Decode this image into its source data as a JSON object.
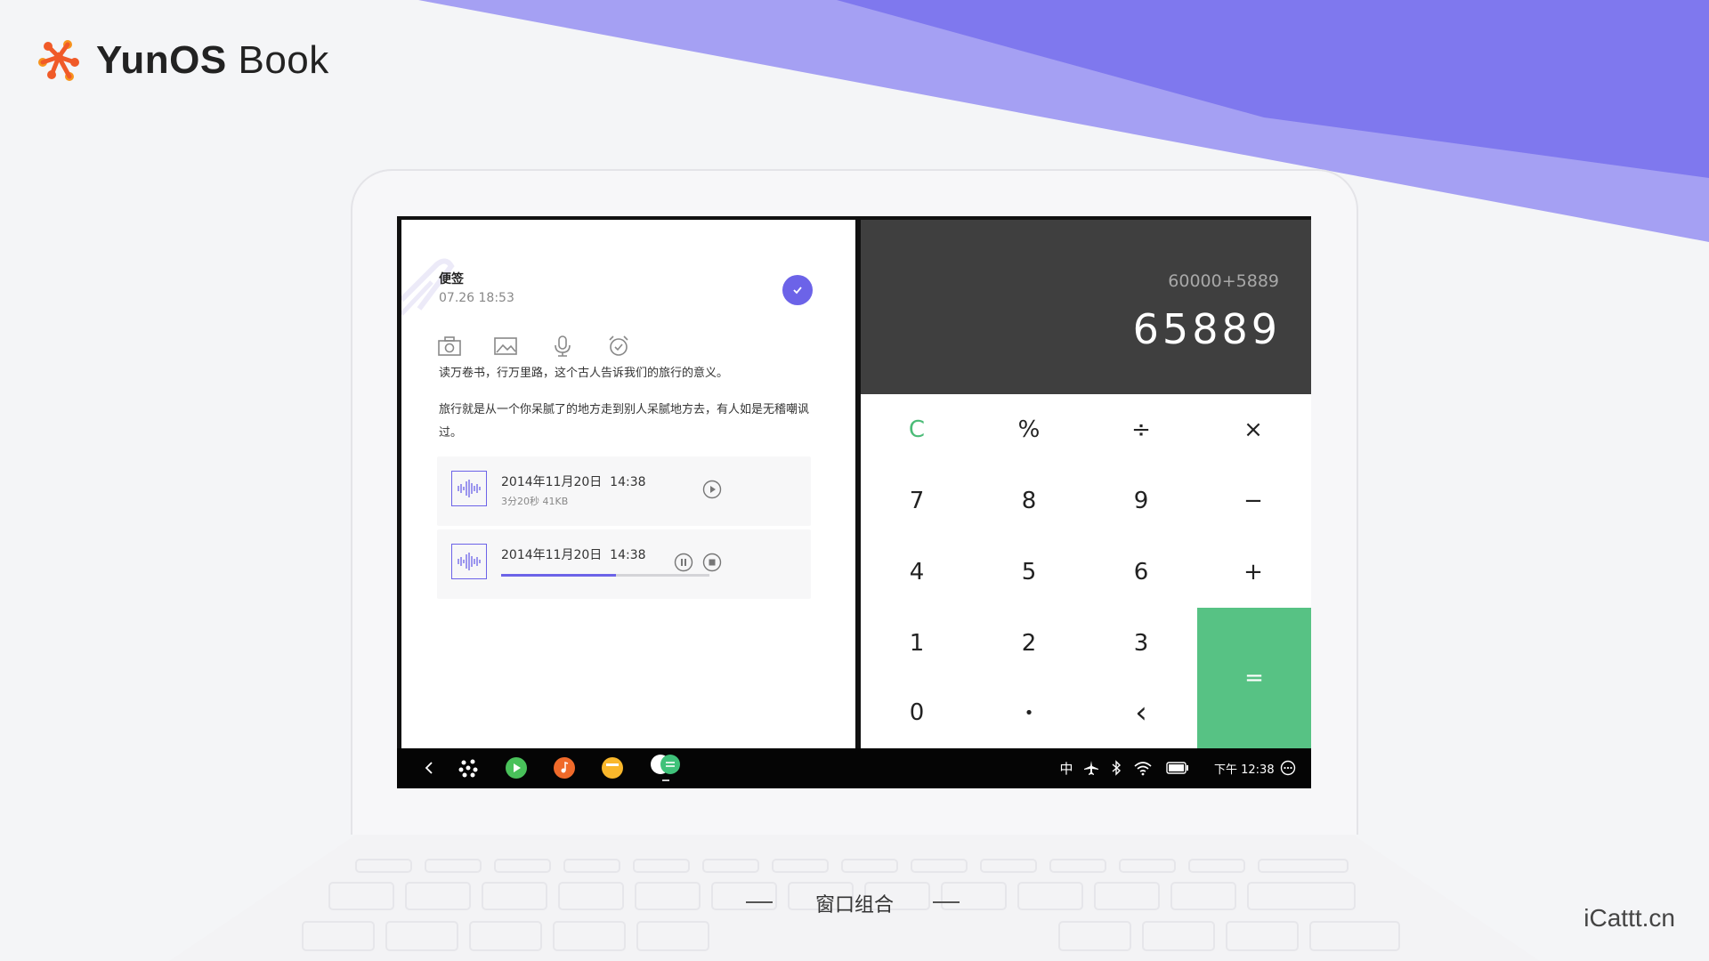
{
  "brand": {
    "name_bold": "YunOS",
    "name_light": " Book"
  },
  "notes": {
    "title": "便签",
    "date": "07.26 18:53",
    "paragraph1": "读万卷书，行万里路，这个古人告诉我们的旅行的意义。",
    "paragraph2": "旅行就是从一个你呆腻了的地方走到别人呆腻地方去，有人如是无稽嘲讽过。",
    "recordings": [
      {
        "date": "2014年11月20日",
        "time": "14:38",
        "meta": "3分20秒  41KB",
        "state": "stopped"
      },
      {
        "date": "2014年11月20日",
        "time": "14:38",
        "state": "playing",
        "progress": 0.55
      }
    ]
  },
  "calculator": {
    "expression": "60000+5889",
    "result": "65889",
    "keys": {
      "clear": "C",
      "percent": "%",
      "divide": "÷",
      "multiply": "×",
      "seven": "7",
      "eight": "8",
      "nine": "9",
      "minus": "−",
      "four": "4",
      "five": "5",
      "six": "6",
      "plus": "+",
      "one": "1",
      "two": "2",
      "three": "3",
      "equals": "=",
      "zero": "0",
      "dot": "•",
      "backspace": "‹"
    },
    "equals_color": "#57c284",
    "clear_color": "#4cbc78"
  },
  "taskbar": {
    "ime": "中",
    "time": "下午 12:38"
  },
  "caption": "窗口组合",
  "watermark": "iCattt.cn",
  "colors": {
    "accent": "#6c63e8",
    "background": "#f4f5f7"
  }
}
